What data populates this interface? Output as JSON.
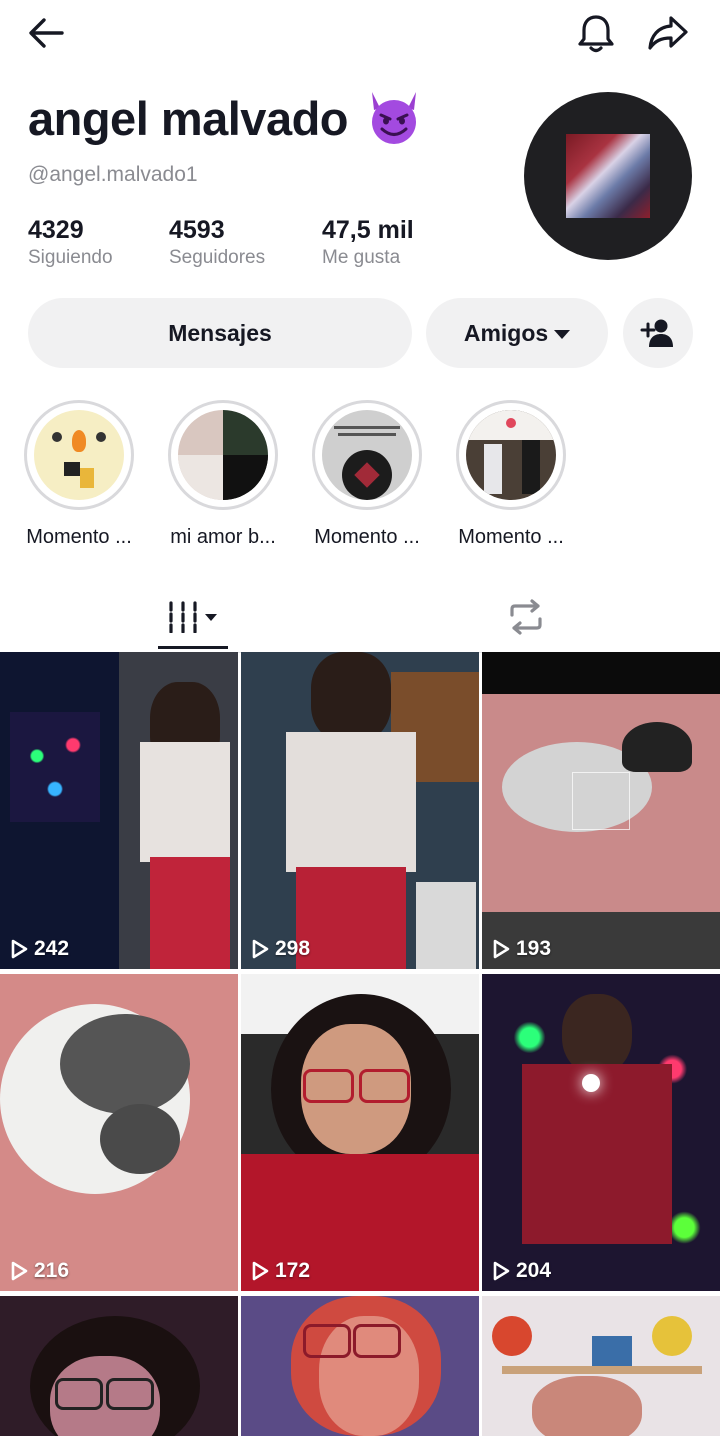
{
  "profile": {
    "display_name": "angel malvado",
    "username": "@angel.malvado1",
    "stats": [
      {
        "value": "4329",
        "label": "Siguiendo"
      },
      {
        "value": "4593",
        "label": "Seguidores"
      },
      {
        "value": "47,5 mil",
        "label": "Me gusta"
      }
    ]
  },
  "actions": {
    "messages_label": "Mensajes",
    "friends_label": "Amigos"
  },
  "highlights": [
    {
      "label": "Momento ..."
    },
    {
      "label": "mi amor b..."
    },
    {
      "label": "Momento ..."
    },
    {
      "label": "Momento ..."
    }
  ],
  "icons": {
    "back": "arrow-left-icon",
    "notifications": "bell-icon",
    "share": "share-icon",
    "add_friend": "add-user-icon",
    "grid_tab": "videos-grid-icon",
    "repost_tab": "repost-icon",
    "play": "play-icon"
  },
  "videos": [
    {
      "views": "242"
    },
    {
      "views": "298"
    },
    {
      "views": "193"
    },
    {
      "views": "216"
    },
    {
      "views": "172"
    },
    {
      "views": "204"
    },
    {
      "views": ""
    },
    {
      "views": ""
    },
    {
      "views": ""
    }
  ]
}
